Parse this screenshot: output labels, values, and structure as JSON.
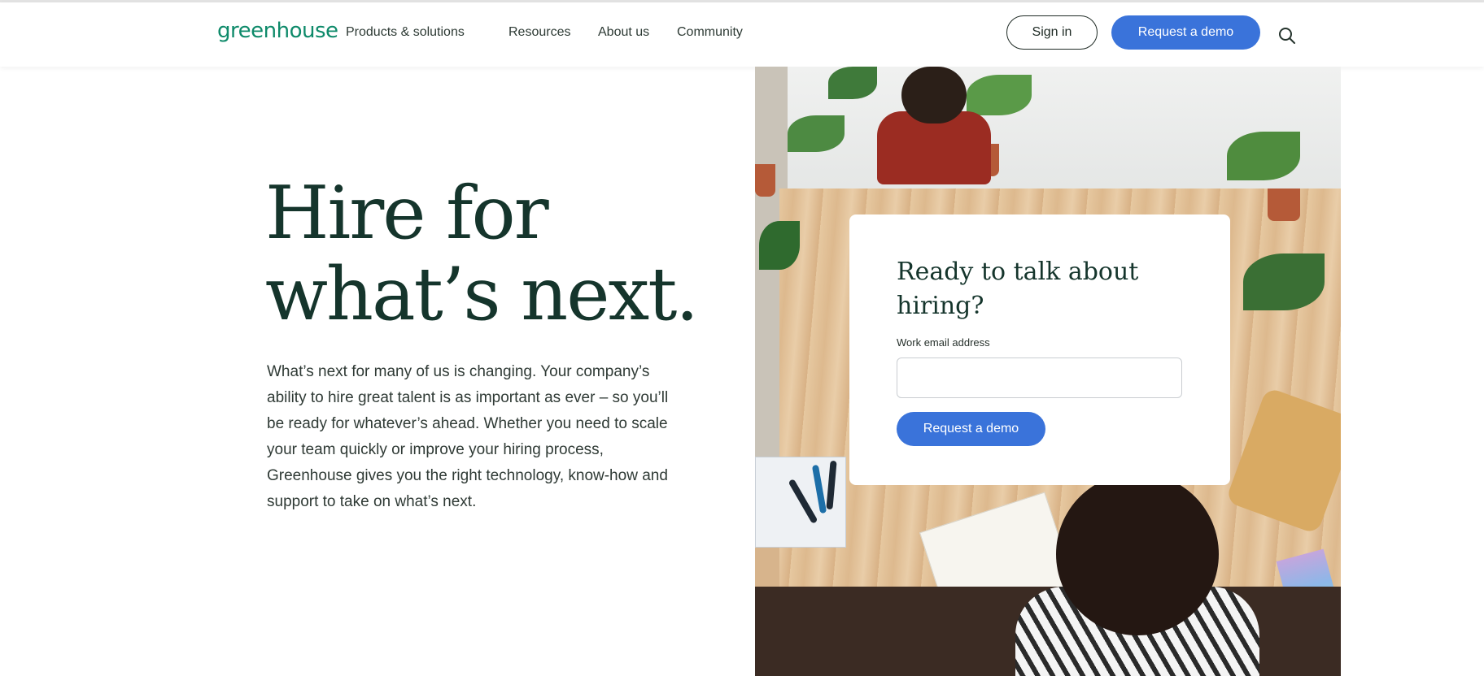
{
  "header": {
    "logo": "greenhouse",
    "nav": [
      "Products & solutions",
      "Resources",
      "About us",
      "Community"
    ],
    "sign_in": "Sign in",
    "request_demo": "Request a demo",
    "search_icon": "search-icon"
  },
  "hero": {
    "headline_line1": "Hire for",
    "headline_line2": "what’s next.",
    "body": "What’s next for many of us is changing. Your company’s ability to hire great talent is as important as ever – so you’ll be ready for whatever’s ahead. Whether you need to scale your team quickly or improve your hiring process, Greenhouse gives you the right technology, know-how and support to take on what’s next."
  },
  "form_card": {
    "title": "Ready to talk about hiring?",
    "email_label": "Work email address",
    "email_value": "",
    "button": "Request a demo"
  },
  "colors": {
    "brand_green": "#0e8a6a",
    "heading": "#15352c",
    "accent_blue": "#3a73da"
  }
}
